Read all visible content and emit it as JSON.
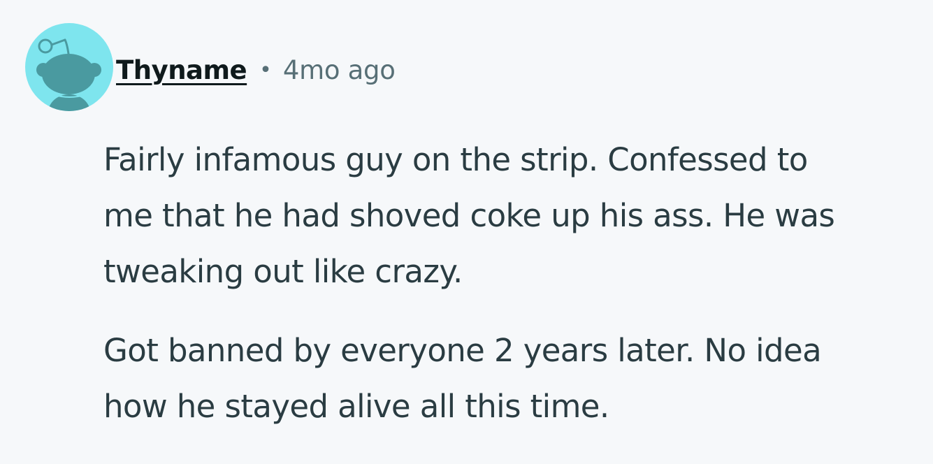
{
  "comment": {
    "avatar_icon": "reddit-snoo-avatar-icon",
    "author": "Thyname",
    "separator": "•",
    "timestamp": "4mo ago",
    "paragraphs": [
      {
        "lines": [
          "Fairly infamous guy on the strip. Confessed to",
          "me that he had shoved coke up his ass. He was",
          "tweaking out like crazy."
        ]
      },
      {
        "lines": [
          "Got banned by everyone 2 years later. No idea",
          "how he stayed alive all this time."
        ]
      }
    ]
  },
  "colors": {
    "background": "#f6f8fa",
    "avatar_bg": "#7ee5ee",
    "avatar_figure": "#4a9aa0",
    "username": "#0f1a1c",
    "meta_text": "#576f76",
    "body_text": "#2a3c42"
  }
}
